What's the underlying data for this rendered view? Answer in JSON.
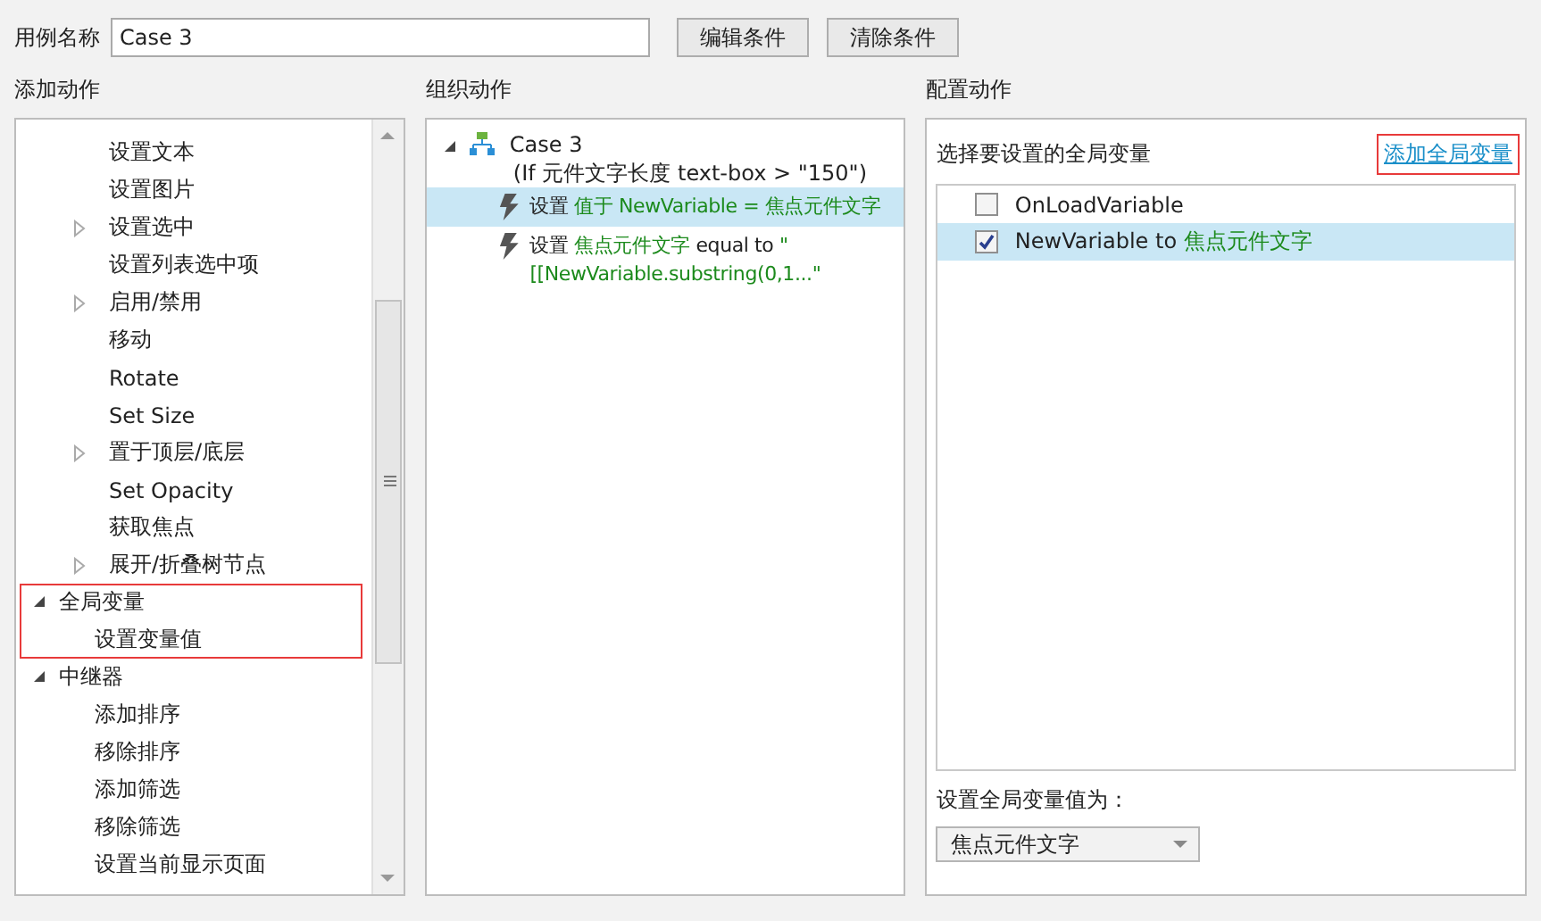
{
  "case_name": {
    "label": "用例名称",
    "value": "Case 3"
  },
  "buttons": [
    "编辑条件",
    "清除条件"
  ],
  "add_actions": {
    "title": "添加动作",
    "items": [
      {
        "kind": "action",
        "label": "设置文本",
        "has_children": false
      },
      {
        "kind": "action",
        "label": "设置图片",
        "has_children": false
      },
      {
        "kind": "action",
        "label": "设置选中",
        "has_children": true
      },
      {
        "kind": "action",
        "label": "设置列表选中项",
        "has_children": false
      },
      {
        "kind": "action",
        "label": "启用/禁用",
        "has_children": true
      },
      {
        "kind": "action",
        "label": "移动",
        "has_children": false
      },
      {
        "kind": "action",
        "label": "Rotate",
        "has_children": false
      },
      {
        "kind": "action",
        "label": "Set Size",
        "has_children": false
      },
      {
        "kind": "action",
        "label": "置于顶层/底层",
        "has_children": true
      },
      {
        "kind": "action",
        "label": "Set Opacity",
        "has_children": false
      },
      {
        "kind": "action",
        "label": "获取焦点",
        "has_children": false
      },
      {
        "kind": "action",
        "label": "展开/折叠树节点",
        "has_children": true
      },
      {
        "kind": "group",
        "label": "全局变量",
        "expanded": true,
        "highlighted": true,
        "children": [
          {
            "label": "设置变量值"
          }
        ]
      },
      {
        "kind": "group",
        "label": "中继器",
        "expanded": true,
        "highlighted": false,
        "children": [
          {
            "label": "添加排序"
          },
          {
            "label": "移除排序"
          },
          {
            "label": "添加筛选"
          },
          {
            "label": "移除筛选"
          },
          {
            "label": "设置当前显示页面"
          }
        ]
      }
    ]
  },
  "organize_actions": {
    "title": "组织动作",
    "case": {
      "label": "Case 3",
      "condition": "(If 元件文字长度 text-box > \"150\")",
      "expanded": true
    },
    "actions": [
      {
        "selected": true,
        "parts": [
          {
            "kind": "plain",
            "text": "设置"
          },
          {
            "kind": "value",
            "text": "值于 NewVariable = 焦点元件文字"
          }
        ]
      },
      {
        "selected": false,
        "parts": [
          {
            "kind": "plain",
            "text": "设置"
          },
          {
            "kind": "value",
            "text": "焦点元件文字"
          },
          {
            "kind": "plain",
            "text": "equal to"
          },
          {
            "kind": "value",
            "text": "\"[[NewVariable.substring(0,1...\""
          }
        ]
      }
    ]
  },
  "configure_actions": {
    "title": "配置动作",
    "prompt": "选择要设置的全局变量",
    "add_link": {
      "label": "添加全局变量",
      "highlighted": true
    },
    "variables": [
      {
        "name": "OnLoadVariable",
        "checked": false,
        "selected": false
      },
      {
        "name": "NewVariable to",
        "value": "焦点元件文字",
        "checked": true,
        "selected": true
      }
    ],
    "value_label": "设置全局变量值为：",
    "value_select": "焦点元件文字"
  }
}
